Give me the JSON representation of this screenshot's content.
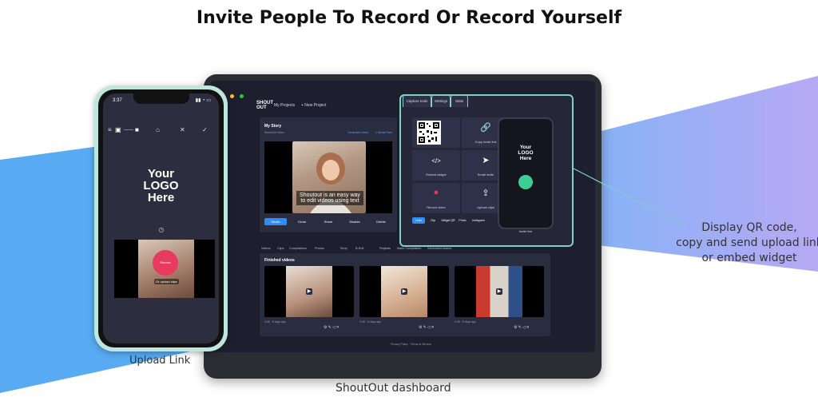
{
  "headline": "Invite People To Record Or Record Yourself",
  "captions": {
    "upload_link": "Upload Link",
    "dashboard": "ShoutOut dashboard",
    "annotation_line1": "Display QR code,",
    "annotation_line2": "copy and send upload link",
    "annotation_line3": "or embed widget"
  },
  "colors": {
    "accent_teal": "#7fd0c6",
    "record_red": "#e83a5f",
    "primary_blue": "#2f8ef5",
    "bg_blue": "#58aaf2",
    "bg_purple": "#b7a9f4"
  },
  "dashboard": {
    "brand_line1": "SHOUT",
    "brand_line2": "OUT",
    "nav_my_projects": "My Projects",
    "nav_new_project": "+ New Project",
    "story_title": "My Story",
    "story_subtitle": "ShoutOut Video",
    "story_link1": "Generated Video",
    "story_link2": "1 Media Files",
    "subtitle_text": "Shoutout is an easy way to edit videos using text",
    "buttons": [
      "Studio",
      "Clone",
      "Share",
      "Disable",
      "Delete"
    ],
    "tabs": [
      "Videos",
      "Clips",
      "Compilations",
      "Photos",
      "Story",
      "B-Roll",
      "Playlists",
      "Make Compilation",
      "Scheduled shares"
    ],
    "finished_title": "Finished videos",
    "thumb_meta": [
      "0:05 · 8 days ago",
      "0:05 · 8 days ago",
      "0:05 · 8 days ago"
    ],
    "footer": "Privacy Policy · Terms of Service"
  },
  "popup": {
    "tabs": [
      "Capture tools",
      "Settings",
      "Stats"
    ],
    "grid_labels": [
      "",
      "Copy invite link",
      "Embed widget",
      "Email invite",
      "Record video",
      "Upload clips"
    ],
    "grid_icons": [
      "qr-code-icon",
      "link-icon",
      "code-icon",
      "send-icon",
      "record-icon",
      "upload-icon"
    ],
    "bottom_buttons": [
      "Links",
      "Clip",
      "Widget QR",
      "Photo",
      "Instagram"
    ],
    "mini_logo_line1": "Your",
    "mini_logo_line2": "LOGO",
    "mini_logo_line3": "Here",
    "invite_link_label": "Invite link"
  },
  "phone": {
    "time": "3:37",
    "logo_line1": "Your",
    "logo_line2": "LOGO",
    "logo_line3": "Here",
    "record_label": "Record",
    "upload_chip": "Or upload clips"
  }
}
